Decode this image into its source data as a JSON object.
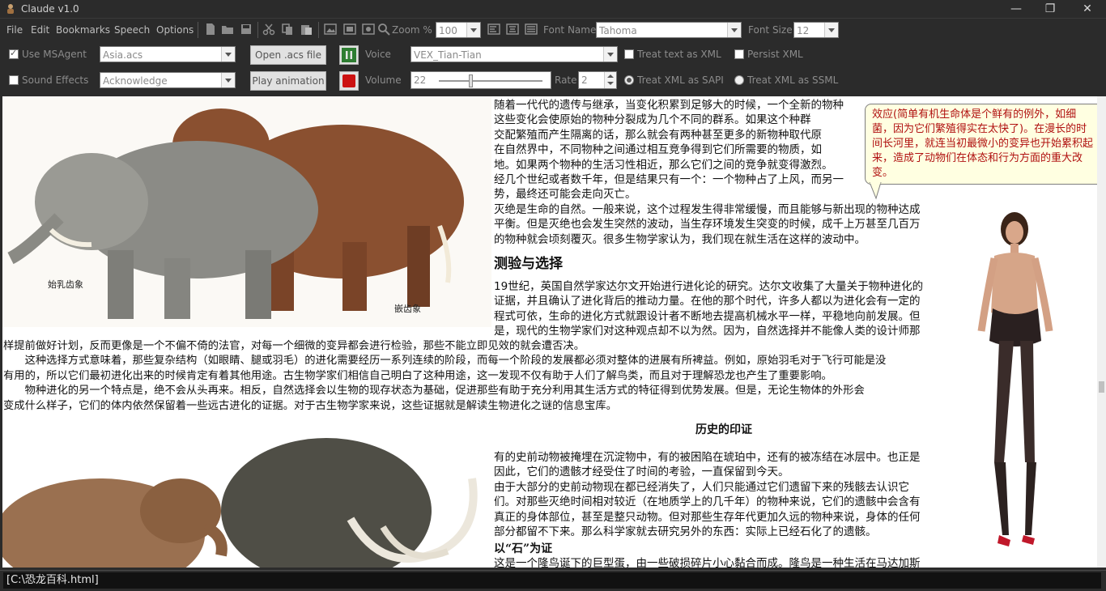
{
  "window": {
    "title": "Claude v1.0"
  },
  "menus": [
    "File",
    "Edit",
    "Bookmarks",
    "Speech",
    "Options"
  ],
  "toolbar": {
    "zoom_label": "Zoom %",
    "zoom_value": "100",
    "font_name_label": "Font Name",
    "font_name_value": "Tahoma",
    "font_size_label": "Font Size",
    "font_size_value": "12"
  },
  "controls": {
    "use_msagent_label": "Use MSAgent",
    "agent_file": "Asia.acs",
    "open_acs_label": "Open .acs file",
    "voice_label": "Voice",
    "voice_value": "VEX_Tian-Tian",
    "treat_text_xml_label": "Treat text as XML",
    "persist_xml_label": "Persist XML",
    "sound_effects_label": "Sound Effects",
    "animation_value": "Acknowledge",
    "play_animation_label": "Play animation",
    "volume_label": "Volume",
    "volume_value": "22",
    "volume_level": 0.3,
    "rate_label": "Rate",
    "rate_value": "2",
    "treat_xml_sapi_label": "Treat XML as SAPI",
    "treat_xml_ssml_label": "Treat XML as SSML"
  },
  "document": {
    "caption1": "始乳齿象",
    "caption2": "嵌齿象",
    "para1_lines": [
      "随着一代代的遗传与继承，当变化积累到足够大的时候，一个全新的物种",
      "这些变化会使原始的物种分裂成为几个不同的群系。如果这个种群",
      "交配繁殖而产生隔离的话，那么就会有两种甚至更多的新物种取代原",
      "在自然界中，不同物种之间通过相互竞争得到它们所需要的物质，如",
      "地。如果两个物种的生活习性相近，那么它们之间的竞争就变得激烈。",
      "经几个世纪或者数千年，但是结果只有一个：一个物种占了上风，而另一",
      "势，最终还可能会走向灭亡。",
      "灭绝是生命的自然。一般来说，这个过程发生得非常缓慢，而且能够与新出现的物种达成",
      "平衡。但是灭绝也会发生突然的波动，当生存环境发生突变的时候，成千上万甚至几百万",
      "的物种就会顷刻覆灭。很多生物学家认为，我们现在就生活在这样的波动中。"
    ],
    "heading1": "测验与选择",
    "para2_lines": [
      "19世纪，英国自然学家达尔文开始进行进化论的研究。达尔文收集了大量关于物种进化的",
      "证据，并且确认了进化背后的推动力量。在他的那个时代，许多人都以为进化会有一定的",
      "程式可依，生命的进化方式就跟设计者不断地去提高机械水平一样，平稳地向前发展。但",
      "是，现代的生物学家们对这种观点却不以为然。因为，自然选择并不能像人类的设计师那"
    ],
    "para3_lines": [
      "样提前做好计划，反而更像是一个不偏不倚的法官，对每一个细微的变异都会进行检验，那些不能立即见效的就会遭否决。",
      "　　这种选择方式意味着，那些复杂结构（如眼睛、腿或羽毛）的进化需要经历一系列连续的阶段，而每一个阶段的发展都必须对整体的进展有所裨益。例如，原始羽毛对于飞行可能是没",
      "有用的，所以它们最初进化出来的时候肯定有着其他用途。古生物学家们相信自己明白了这种用途，这一发现不仅有助于人们了解鸟类，而且对于理解恐龙也产生了重要影响。",
      "　　物种进化的另一个特点是，绝不会从头再来。相反，自然选择会以生物的现存状态为基础，促进那些有助于充分利用其生活方式的特征得到优势发展。但是，无论生物体的外形会",
      "变成什么样子，它们的体内依然保留着一些远古进化的证据。对于古生物学家来说，这些证据就是解读生物进化之谜的信息宝库。"
    ],
    "heading2": "历史的印证",
    "para4_lines": [
      "有的史前动物被掩埋在沉淀物中，有的被困陷在琥珀中，还有的被冻结在冰层中。也正是",
      "因此，它们的遗骸才经受住了时间的考验，一直保留到今天。",
      "由于大部分的史前动物现在都已经消失了，人们只能通过它们遗留下来的残骸去认识它",
      "们。对那些灭绝时间相对较近（在地质学上的几千年）的物种来说，它们的遗骸中会含有",
      "真正的身体部位，甚至是整只动物。但对那些生存年代更加久远的物种来说，身体的任何",
      "部分都留不下来。那么科学家就去研究另外的东西：实际上已经石化了的遗骸。"
    ],
    "heading3": "以“石”为证",
    "para5_line": "这是一个隆鸟诞下的巨型蛋，由一些破损碎片小心黏合而成。隆鸟是一种生活在马达加斯"
  },
  "balloon": {
    "text": "效应(简单有机生命体是个鲜有的例外，如细菌，因为它们繁殖得实在太快了)。在漫长的时间长河里，就连当初最微小的变异也开始累积起来，造成了动物们在体态和行为方面的重大改变。"
  },
  "status": {
    "path": "[C:\\恐龙百科.html]"
  },
  "colors": {
    "chrome": "#2b2b2b",
    "balloon_bg": "#ffffe1",
    "balloon_text": "#b01010",
    "record_red": "#cc1111",
    "play_green": "#2e7d32"
  }
}
